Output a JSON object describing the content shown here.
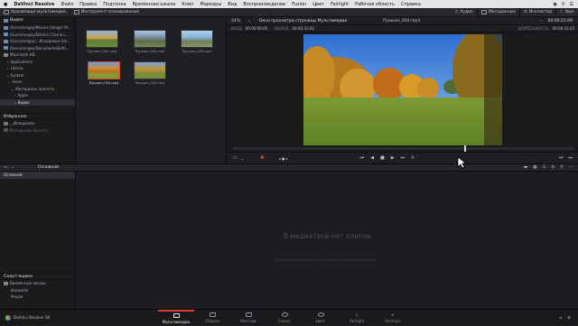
{
  "menubar": {
    "app_name": "DaVinci Resolve",
    "items": [
      "Файл",
      "Правка",
      "Подгонка",
      "Временная шкала",
      "Клип",
      "Маркеры",
      "Вид",
      "Воспроизведение",
      "Fusion",
      "Цвет",
      "Fairlight",
      "Рабочая область",
      "Справка"
    ]
  },
  "toolbar": {
    "media_storage": "Хранилище мультимедиа",
    "clone_tool": "Инструмент клонирования",
    "audio": "Аудио",
    "metadata": "Метаданные",
    "inspector": "Инспектор",
    "sound": "Звук"
  },
  "viewer": {
    "zoom": "34%",
    "title": "Окно просмотра страницы Мультимедиа",
    "clip_name": "Пушкин_004.mp4",
    "timecode": "00:00:21:09",
    "in_label": "ВХОД",
    "in_tc": "00:00:00:00",
    "out_label": "ВЫХОД",
    "out_tc": "00:00:31:02",
    "duration_label": "ДЛИТЕЛЬНОСТЬ",
    "duration_tc": "00:00:31:03",
    "playhead_fraction": 0.68
  },
  "sidebar": {
    "header": "Видео",
    "items": [
      "/Users/sergey/Movies (Image 'M...",
      "/Users/sergey/DaVinci Charla L...",
      "/Users/sergey/...Исходники (Im...",
      "/Users/sergey/Documents/Editi...",
      "Macintosh HD",
      "Applications",
      "Library",
      "System",
      "Users",
      "Материалы проекта",
      "Apple",
      "Видео"
    ],
    "favorites_header": "Избранное",
    "favorites": [
      "__Исходники",
      "Материалы проекта"
    ]
  },
  "clips": [
    {
      "name": "Пушкин_001.mp4",
      "selected": false
    },
    {
      "name": "Пушкин_002.mp4",
      "selected": false
    },
    {
      "name": "Пушкин_003.mp4",
      "selected": false
    },
    {
      "name": "Пушкин_004.mp4",
      "selected": true
    },
    {
      "name": "Пушкин_005.mp4",
      "selected": false
    }
  ],
  "mediapool": {
    "bin_label": "Основной",
    "master_item": "Основной",
    "empty_title": "В медиатеке нет клипов",
    "empty_sub": "Для начала добавьте клипы из хранилища мультимедиа",
    "smart_bins_header": "Смарт-ящики",
    "smart_bins": [
      "Временные шкалы",
      "Keywords",
      "People"
    ]
  },
  "bottombar": {
    "app_label": "DaVinci Resolve 18",
    "pages": [
      {
        "label": "Мультимедиа",
        "active": true
      },
      {
        "label": "Сборка",
        "active": false
      },
      {
        "label": "Монтаж",
        "active": false
      },
      {
        "label": "Fusion",
        "active": false
      },
      {
        "label": "Цвет",
        "active": false
      },
      {
        "label": "Fairlight",
        "active": false
      },
      {
        "label": "Экспорт",
        "active": false
      }
    ]
  },
  "colors": {
    "accent": "#d9442e",
    "panel": "#1e1e22"
  }
}
